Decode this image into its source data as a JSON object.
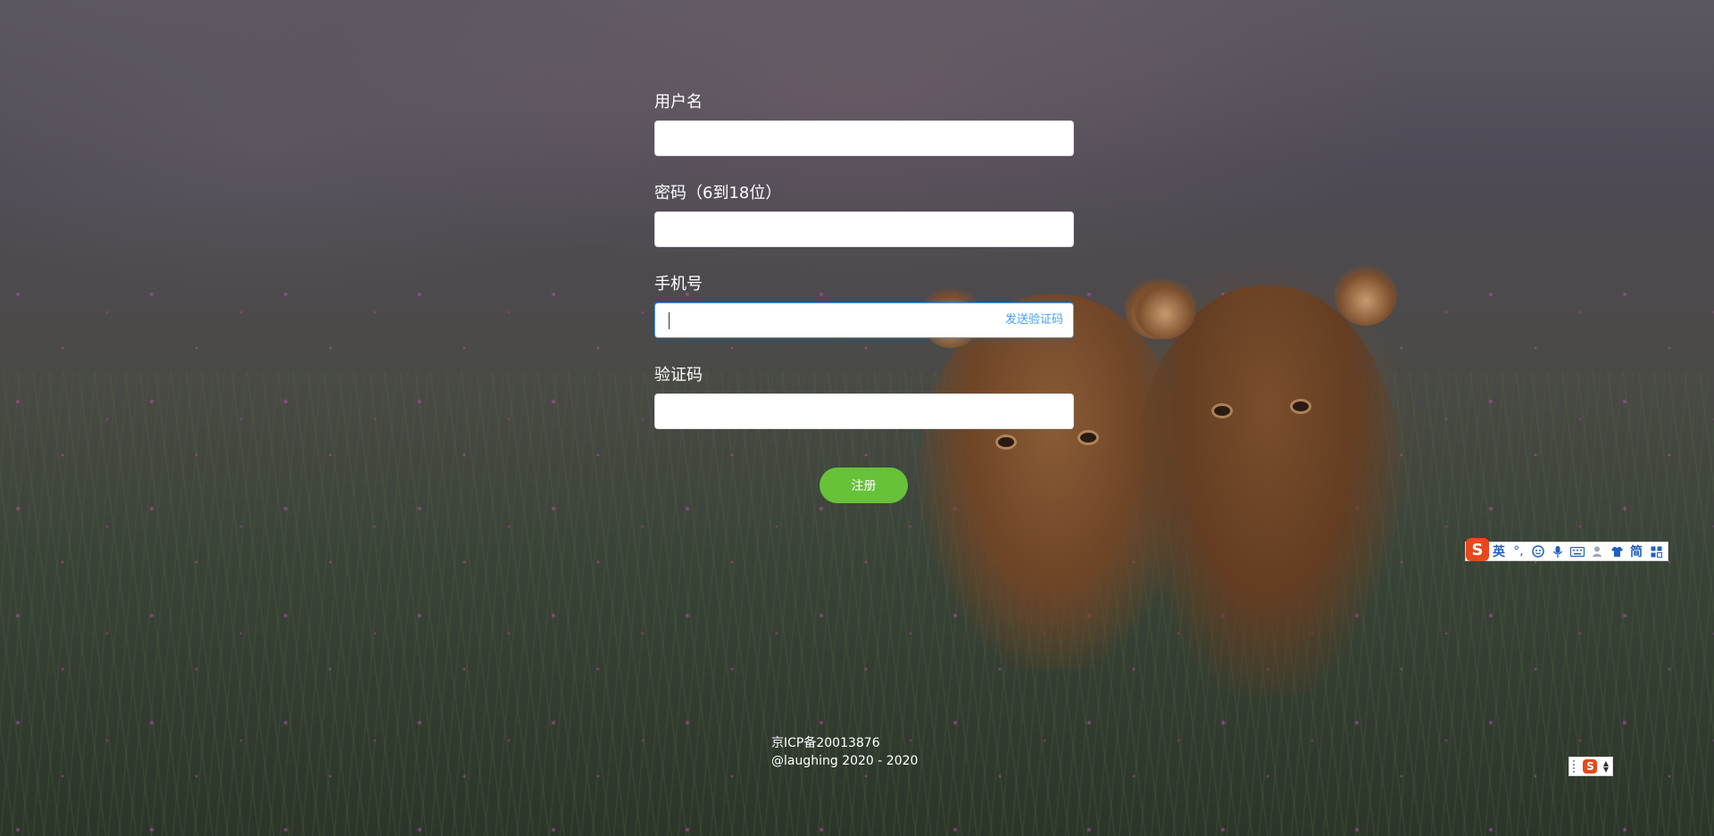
{
  "form": {
    "username": {
      "label": "用户名",
      "value": "",
      "placeholder": ""
    },
    "password": {
      "label": "密码（6到18位）",
      "value": "",
      "placeholder": ""
    },
    "phone": {
      "label": "手机号",
      "value": "",
      "placeholder": "",
      "send_code_label": "发送验证码"
    },
    "code": {
      "label": "验证码",
      "value": "",
      "placeholder": ""
    },
    "register_label": "注册"
  },
  "footer": {
    "icp": "京ICP备20013876",
    "copyright": "@laughing 2020 - 2020"
  },
  "ime_toolbar": {
    "logo": "S",
    "items": [
      "英",
      "punctuation-icon",
      "emoji-icon",
      "microphone-icon",
      "keyboard-icon",
      "user-icon",
      "skin-icon",
      "简",
      "grid-icon"
    ]
  },
  "ime_mini": {
    "logo": "S"
  },
  "colors": {
    "accent": "#409eff",
    "register": "#67c23a",
    "ime": "#e8481c"
  }
}
